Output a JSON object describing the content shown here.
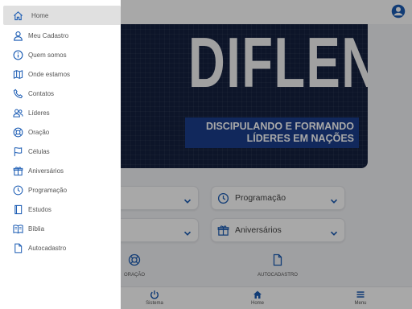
{
  "drawer": {
    "items": [
      {
        "label": "Home",
        "icon": "home-icon",
        "selected": true
      },
      {
        "label": "Meu Cadastro",
        "icon": "person-icon"
      },
      {
        "label": "Quem somos",
        "icon": "info-icon"
      },
      {
        "label": "Onde estamos",
        "icon": "map-icon"
      },
      {
        "label": "Contatos",
        "icon": "phone-icon"
      },
      {
        "label": "Líderes",
        "icon": "people-icon"
      },
      {
        "label": "Oração",
        "icon": "lifebuoy-icon"
      },
      {
        "label": "Células",
        "icon": "flag-icon"
      },
      {
        "label": "Aniversários",
        "icon": "gift-icon"
      },
      {
        "label": "Programação",
        "icon": "clock-icon"
      },
      {
        "label": "Estudos",
        "icon": "book-icon"
      },
      {
        "label": "Bíblia",
        "icon": "open-book-icon"
      },
      {
        "label": "Autocadastro",
        "icon": "document-icon"
      }
    ]
  },
  "header": {
    "account_icon": "account-circle-icon"
  },
  "banner": {
    "brand": "DIFLEN",
    "tagline_line1": "DISCIPULANDO E FORMANDO",
    "tagline_line2": "LÍDERES EM NAÇÕES"
  },
  "quick_pills": {
    "programacao": "Programação",
    "aniversarios": "Aniversários"
  },
  "quick_actions": {
    "oracao": "ORAÇÃO",
    "autocadastro": "AUTOCADASTRO"
  },
  "bottom_nav": {
    "sistema": "Sistema",
    "home": "Home",
    "menu": "Menu"
  },
  "colors": {
    "accent": "#1a5bb3",
    "banner_bg": "#14213f",
    "tagline_bg": "#1a3e8c",
    "drawer_icon": "#1a5bb3",
    "selected_bg": "#e0e0e0"
  }
}
